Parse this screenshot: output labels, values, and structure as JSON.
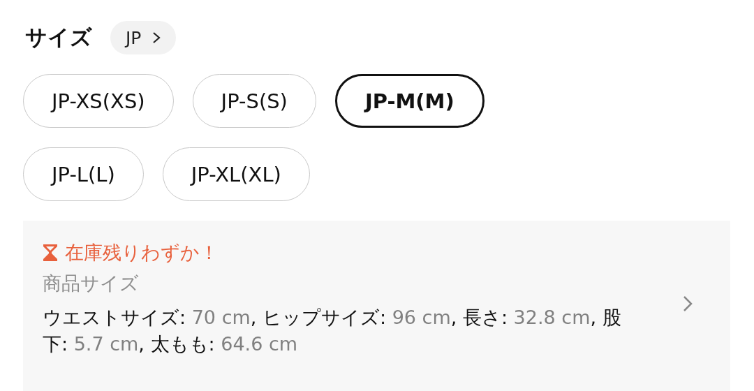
{
  "size_section": {
    "title": "サイズ",
    "region_chip": {
      "label": "JP"
    }
  },
  "sizes": [
    {
      "label": "JP-XS(XS)",
      "selected": false
    },
    {
      "label": "JP-S(S)",
      "selected": false
    },
    {
      "label": "JP-M(M)",
      "selected": true
    },
    {
      "label": "JP-L(L)",
      "selected": false
    },
    {
      "label": "JP-XL(XL)",
      "selected": false
    }
  ],
  "details": {
    "stock_warning": "在庫残りわずか！",
    "heading": "商品サイズ",
    "measurements": [
      {
        "label": "ウエストサイズ: ",
        "value": "70 cm"
      },
      {
        "label": ", ヒップサイズ: ",
        "value": "96 cm"
      },
      {
        "label": ", 長さ: ",
        "value": "32.8 cm"
      },
      {
        "label": ", 股下: ",
        "value": "5.7 cm"
      },
      {
        "label": ", 太もも: ",
        "value": "64.6 cm"
      }
    ]
  }
}
